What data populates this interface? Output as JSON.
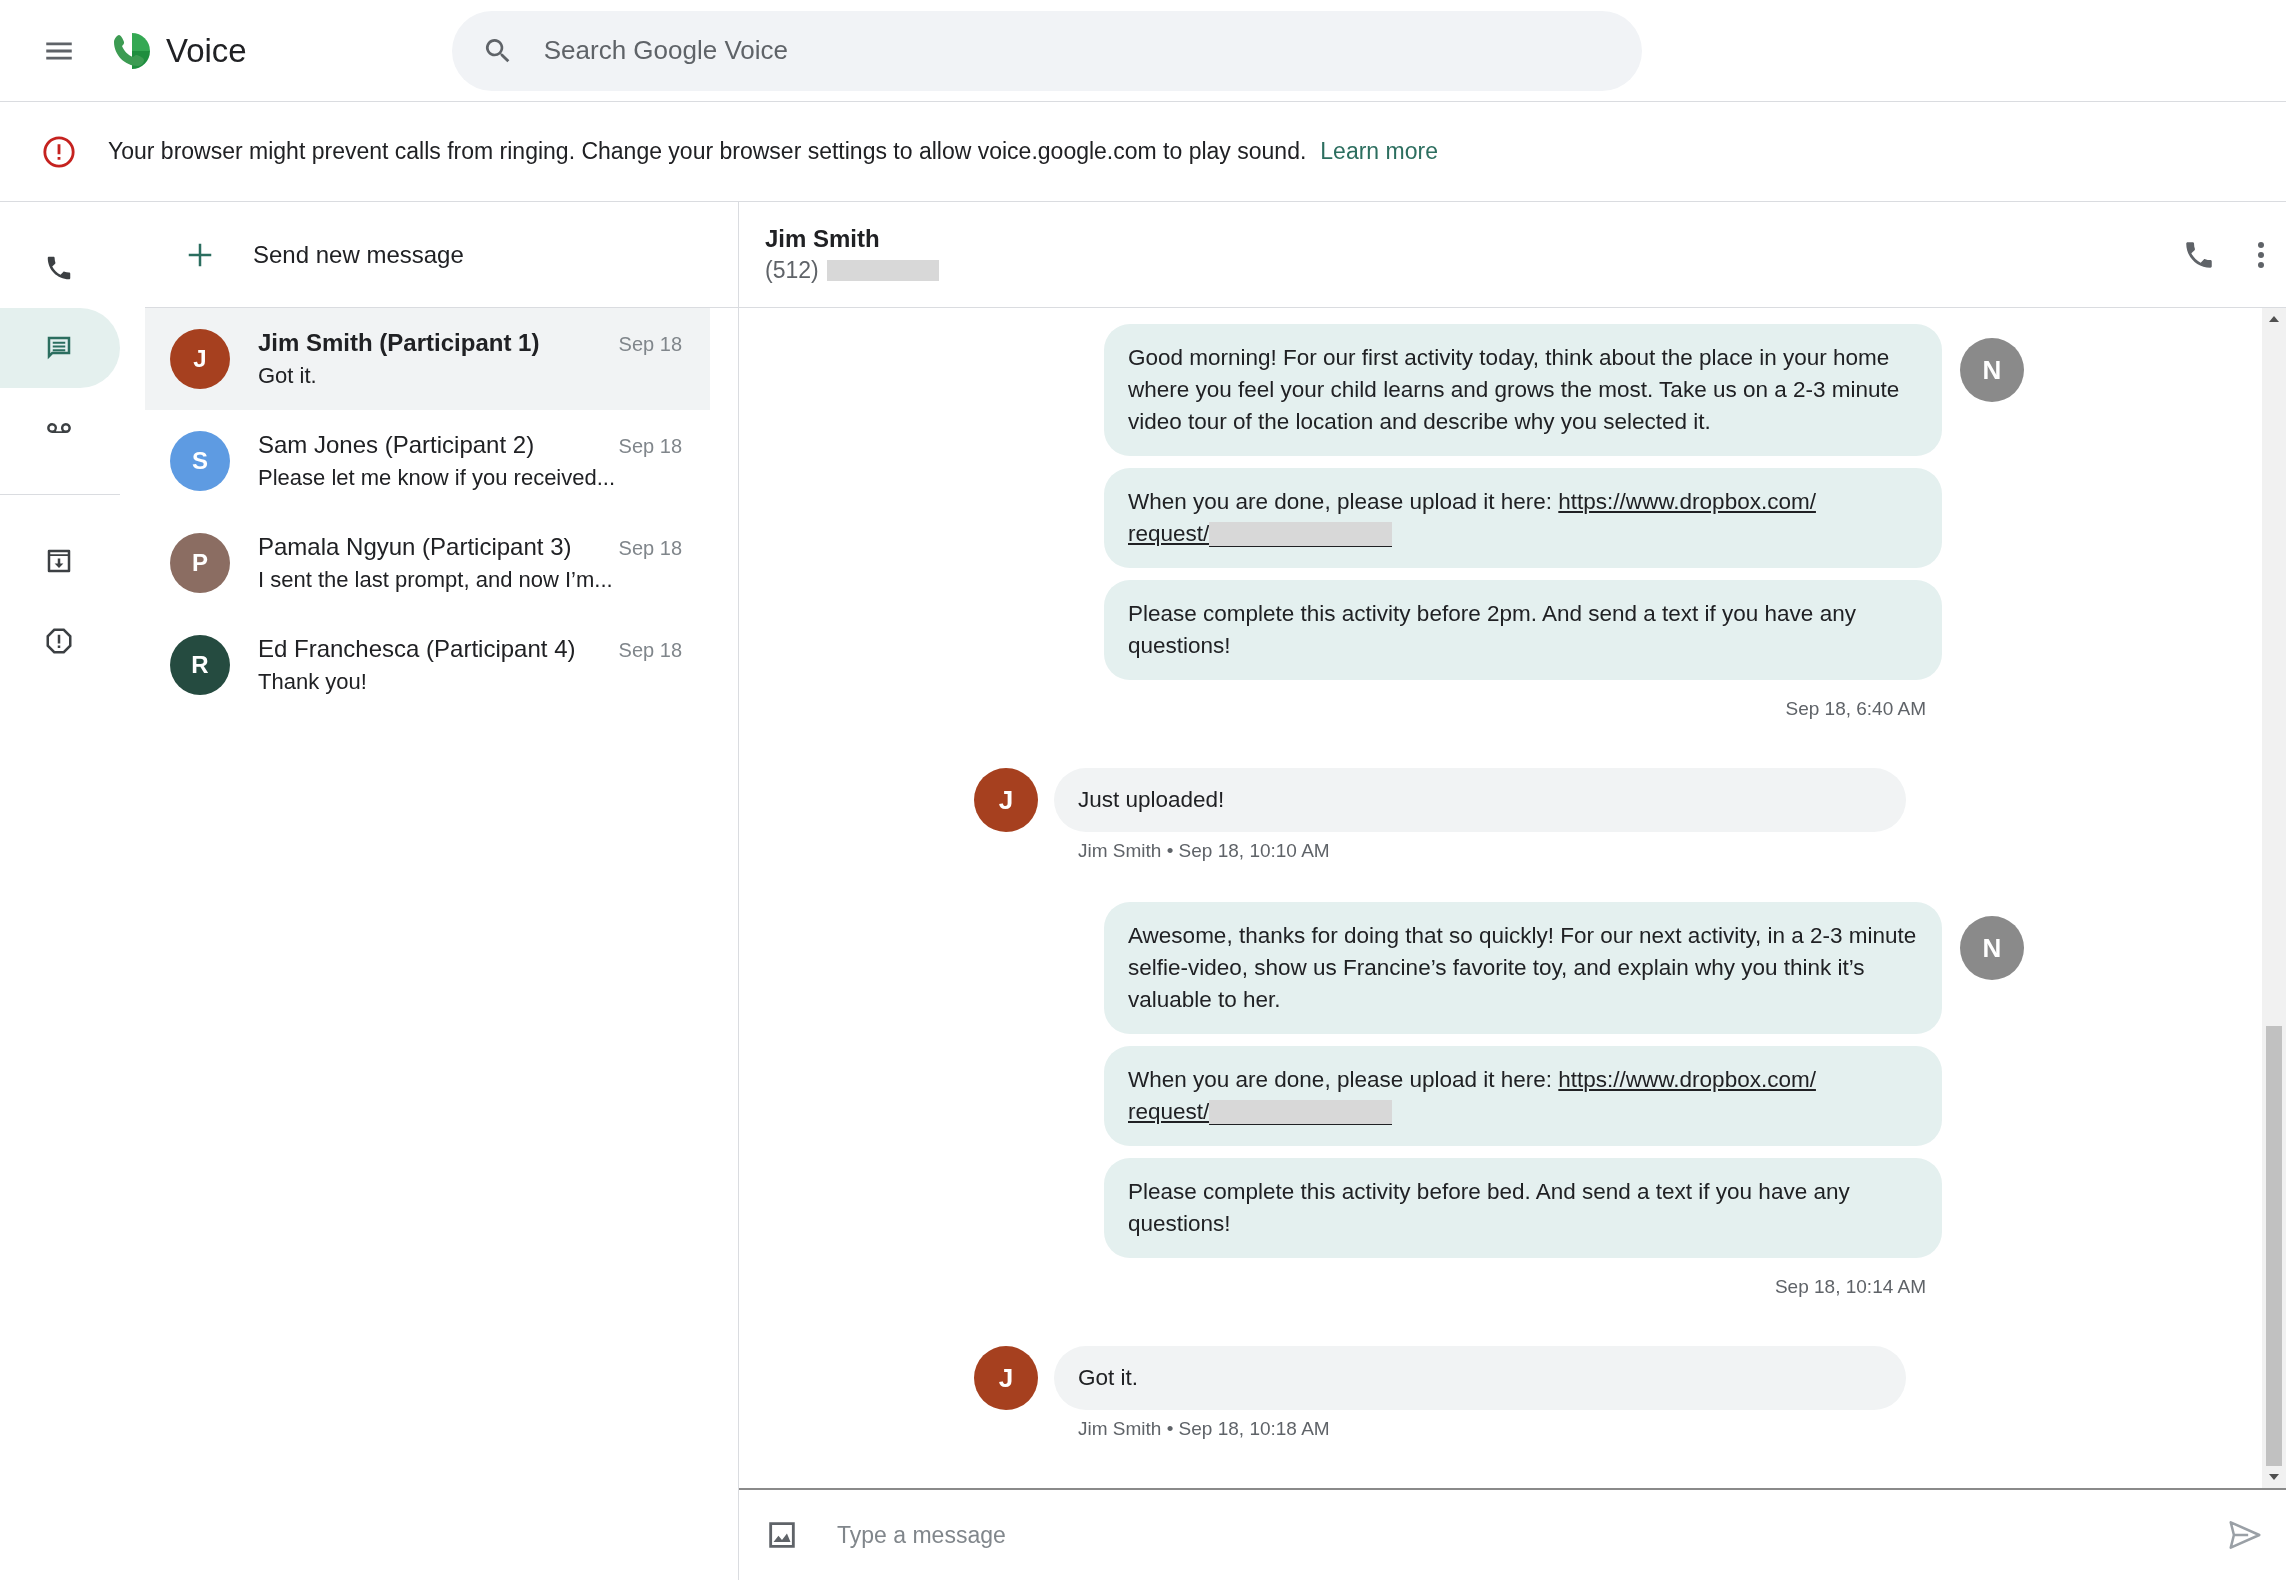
{
  "top_bar": {
    "app_name": "Voice",
    "search": {
      "placeholder": "Search Google Voice"
    }
  },
  "banner": {
    "message": "Your browser might prevent calls from ringing. Change your browser settings to allow voice.google.com to play sound.",
    "link": "Learn more"
  },
  "nav_rail": {
    "primary": [
      {
        "kind": "calls",
        "selected": false
      },
      {
        "kind": "messages",
        "selected": true
      },
      {
        "kind": "voicemail",
        "selected": false
      }
    ],
    "secondary": [
      {
        "kind": "archive",
        "selected": false
      },
      {
        "kind": "spam",
        "selected": false
      }
    ]
  },
  "new_message": {
    "label": "Send new message"
  },
  "conversations": [
    {
      "name": "Jim Smith (Participant 1)",
      "preview": "Got it.",
      "date": "Sep 18",
      "initial": "J",
      "color": "#a6401f",
      "selected": true
    },
    {
      "name": "Sam Jones (Participant 2)",
      "preview": "Please let me know if you received...",
      "date": "Sep 18",
      "initial": "S",
      "color": "#5e9be2",
      "selected": false
    },
    {
      "name": "Pamala Ngyun (Participant 3)",
      "preview": "I sent the last prompt, and now I’m...",
      "date": "Sep 18",
      "initial": "P",
      "color": "#8b6d62",
      "selected": false
    },
    {
      "name": "Ed Franchesca (Participant 4)",
      "preview": "Thank you!",
      "date": "Sep 18",
      "initial": "R",
      "color": "#254b40",
      "selected": false
    }
  ],
  "chat": {
    "header": {
      "name": "Jim Smith",
      "phone": "(512)",
      "redacted": true
    },
    "messages": [
      {
        "kind": "outgoing",
        "initial": "N",
        "color": "#8a8a8a",
        "bubbles": [
          {
            "text": "Good morning! For our first activity today, think about the place in your home where you feel your child learns and grows the most. Take us on a 2-3 minute video tour of the location and describe why you selected it."
          },
          {
            "text": "When you are done, please upload it here:",
            "link": [
              "https://www.dropbox.com/",
              "request/"
            ],
            "redacted": true
          },
          {
            "text": "Please complete this activity before 2pm. And send a text if you have any questions!"
          }
        ],
        "meta": "Sep 18, 6:40 AM"
      },
      {
        "kind": "incoming",
        "initial": "J",
        "color": "#a6401f",
        "bubbles": [
          {
            "text": "Just uploaded!"
          }
        ],
        "meta": "Jim Smith • Sep 18, 10:10 AM"
      },
      {
        "kind": "outgoing",
        "initial": "N",
        "color": "#8a8a8a",
        "bubbles": [
          {
            "text": "Awesome, thanks for doing that so quickly! For our next activity, in a 2-3 minute selfie-video, show us Francine’s favorite toy, and explain why you think it’s valuable to her."
          },
          {
            "text": "When you are done, please upload it here:",
            "link": [
              "https://www.dropbox.com/",
              "request/"
            ],
            "redacted": true
          },
          {
            "text": "Please complete this activity before bed. And send a text if you have any questions!"
          }
        ],
        "meta": "Sep 18, 10:14 AM"
      },
      {
        "kind": "incoming",
        "initial": "J",
        "color": "#a6401f",
        "bubbles": [
          {
            "text": "Got it."
          }
        ],
        "meta": "Jim Smith • Sep 18, 10:18 AM"
      }
    ],
    "composer": {
      "placeholder": "Type a message"
    }
  }
}
